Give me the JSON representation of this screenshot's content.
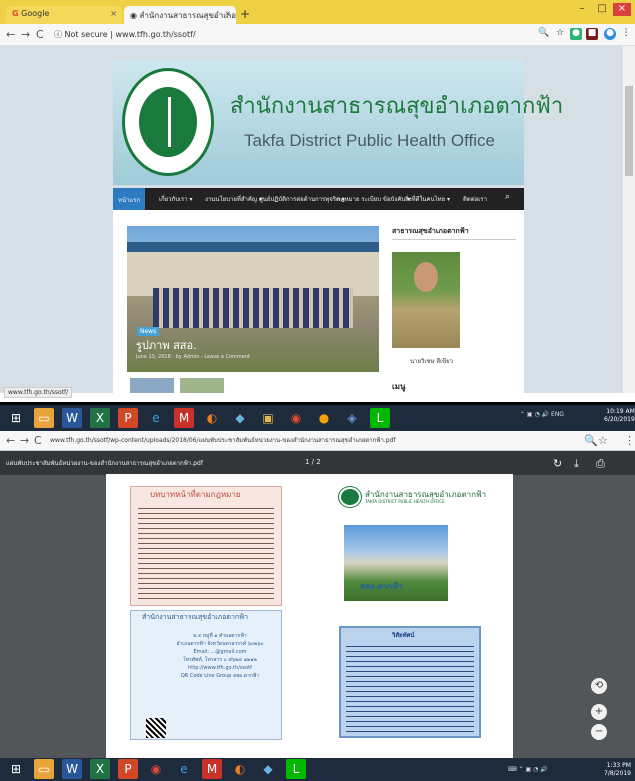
{
  "browser_top": {
    "tabs": [
      {
        "label": "Google",
        "close": "×"
      },
      {
        "label": "สำนักงานสาธารณสุขอำเภอตากฟ้า",
        "close": "×"
      }
    ],
    "new_tab": "+",
    "window_controls": [
      "–",
      "□",
      "×"
    ],
    "address": {
      "secure_label": "Not secure",
      "url": "www.tfh.go.th/ssotf/"
    }
  },
  "site": {
    "title_th": "สำนักงานสาธารณสุขอำเภอตากฟ้า",
    "title_en": "Takfa District Public Health Office",
    "logo_top_text": "กระทรวงสาธารณสุข",
    "logo_bottom_text": "MINISTRY OF PUBLIC HEALTH",
    "nav": [
      "หน้าแรก",
      "เกี่ยวกับเรา ▾",
      "งานนโยบายที่สำคัญ ▾",
      "ศูนย์ปฏิบัติการต่อต้านการทุจริต ▾",
      "กฎหมาย ระเบียบ ข้อบังคับ ▾",
      "สิ่งที่ดีในคนไทย ▾",
      "ติดต่อเรา"
    ],
    "slider": {
      "tag": "News",
      "title": "รูปภาพ สสอ.",
      "meta": "June 13, 2018 - by Admin - Leave a Comment"
    },
    "sidebar": {
      "title": "สาธารณสุขอำเภอตากฟ้า",
      "portrait_name": "นายวิเชษ สีเขียว",
      "heading2": "เมนู"
    },
    "status_url": "www.tfh.go.th/ssotf/"
  },
  "taskbar1": {
    "tray": "ENG",
    "time": "10:19 AM",
    "date": "6/20/2019"
  },
  "browser_pdf": {
    "url": "www.tfh.go.th/ssotf/wp-content/uploads/2018/06/แผ่นพับประชาสัมพันธ์หน่วยงาน-ของสำนักงานสาธารณสุขอำเภอตากฟ้า.pdf",
    "file_name": "แผ่นพับประชาสัมพันธ์หน่วยงาน-ของสำนักงานสาธารณสุขอำเภอตากฟ้า.pdf",
    "page_indicator": "1 / 2",
    "doc": {
      "left_title": "บทบาทหน้าที่ตามกฎหมาย",
      "contact_title": "สำนักงานสาธารณสุขอำเภอตากฟ้า",
      "contact_lines": [
        "ม.x หมู่ที่ ๑ ตำบลตากฟ้า",
        "อำเภอตากฟ้า จังหวัดนครสวรรค์ ๖๐๒๖๐",
        "Email: ...@gmail.com",
        "โทรศัพท์, โทรสาร ๐ ๕๖๒๔ ๑๒๑๒",
        "http://www.tfh.go.th/ssotf",
        "QR Code Line Group สสอ.ตากฟ้า"
      ],
      "right_title_th": "สำนักงานสาธารณสุขอำเภอตากฟ้า",
      "right_title_en": "TAKFA DISTRICT PUBLIC HEALTH OFFICE",
      "photo_caption": "สสอ.ตากฟ้า",
      "vision_title": "วิสัยทัศน์"
    },
    "zoom_buttons": [
      "⟲",
      "+",
      "−"
    ]
  },
  "taskbar2": {
    "time": "1:33 PM",
    "date": "7/8/2019"
  },
  "colors": {
    "accent_green": "#1a7a3e",
    "nav_dark": "#222222",
    "nav_active": "#2e7bc4",
    "tab_yellow": "#f0d146",
    "taskbar": "#1d2b3d"
  }
}
